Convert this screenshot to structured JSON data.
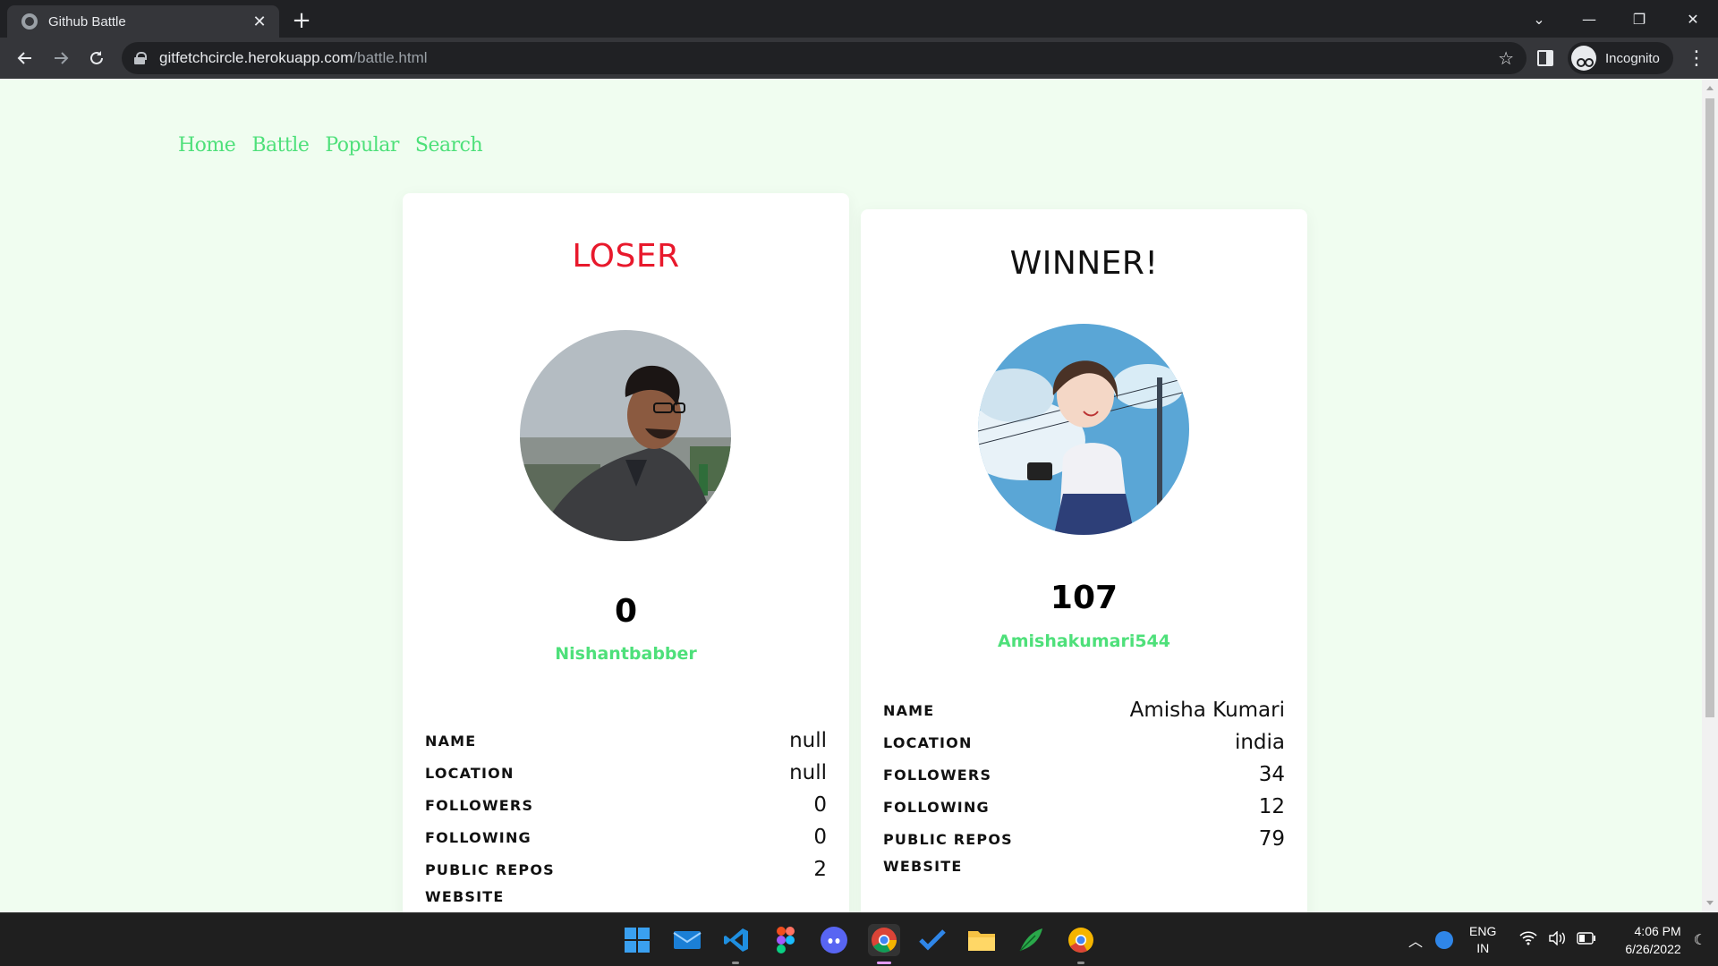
{
  "browser": {
    "tab_title": "Github Battle",
    "tab_close": "✕",
    "new_tab": "+",
    "url_host": "gitfetchcircle.herokuapp.com",
    "url_path": "/battle.html",
    "incognito_label": "Incognito",
    "window_controls": {
      "minimize": "—",
      "restore": "❐",
      "close": "✕",
      "tab_search": "⌄"
    }
  },
  "site_nav": {
    "items": [
      "Home",
      "Battle",
      "Popular",
      "Search"
    ]
  },
  "players": [
    {
      "status": "LOSER",
      "status_color": "#e8192c",
      "score": "0",
      "username": "Nishantbabber",
      "avatar": "photo-man-glasses",
      "info": [
        {
          "label": "NAME",
          "value": "null"
        },
        {
          "label": "LOCATION",
          "value": "null"
        },
        {
          "label": "FOLLOWERS",
          "value": "0"
        },
        {
          "label": "FOLLOWING",
          "value": "0"
        },
        {
          "label": "PUBLIC REPOS",
          "value": "2"
        },
        {
          "label": "WEBSITE",
          "value": ""
        }
      ]
    },
    {
      "status": "WINNER!",
      "status_color": "#111111",
      "score": "107",
      "username": "Amishakumari544",
      "avatar": "anime-girl-camera",
      "info": [
        {
          "label": "NAME",
          "value": "Amisha Kumari"
        },
        {
          "label": "LOCATION",
          "value": "india"
        },
        {
          "label": "FOLLOWERS",
          "value": "34"
        },
        {
          "label": "FOLLOWING",
          "value": "12"
        },
        {
          "label": "PUBLIC REPOS",
          "value": "79"
        },
        {
          "label": "WEBSITE",
          "value": ""
        }
      ]
    }
  ],
  "colors": {
    "accent_green": "#4ee07a",
    "loser_red": "#e8192c",
    "page_bg": "#f0fdf0"
  },
  "taskbar": {
    "apps": [
      "windows-start-icon",
      "mail-icon",
      "vscode-icon",
      "figma-icon",
      "discord-icon",
      "chrome-icon",
      "todo-icon",
      "file-explorer-icon",
      "feather-icon",
      "chrome-canary-icon"
    ],
    "lang_top": "ENG",
    "lang_bottom": "IN",
    "time": "4:06 PM",
    "date": "6/26/2022"
  }
}
